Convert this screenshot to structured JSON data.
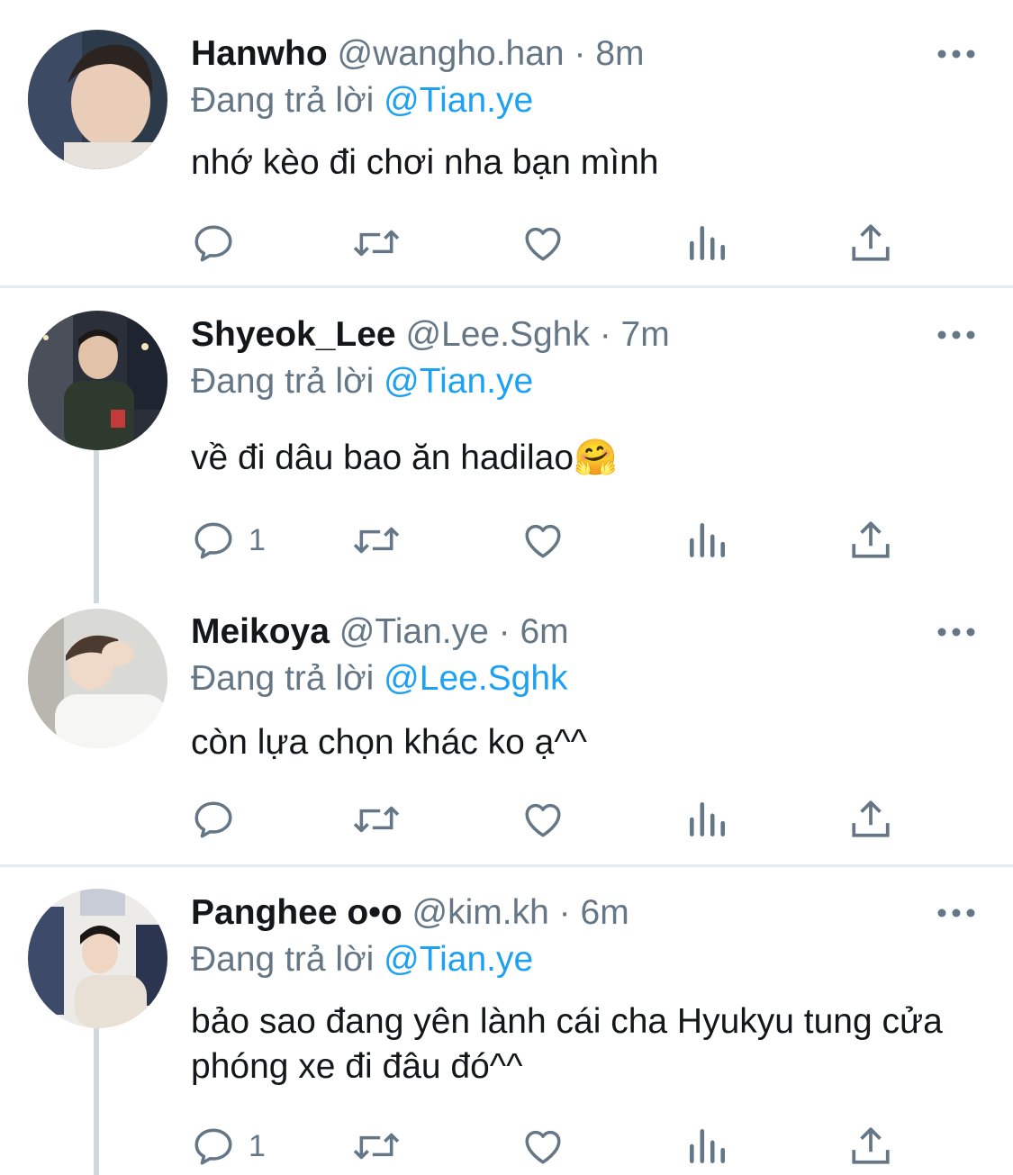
{
  "colors": {
    "accent": "#1da1f2",
    "secondary_text": "#657786",
    "divider": "#e6ecf0"
  },
  "tweets": [
    {
      "name": "Hanwho",
      "handle": "@wangho.han",
      "dot": "·",
      "time": "8m",
      "reply_prefix": "Đang trả lời",
      "reply_to": "@Tian.ye",
      "text": "nhớ kèo đi chơi nha bạn mình",
      "reply_count": ""
    },
    {
      "name": "Shyeok_Lee",
      "handle": "@Lee.Sghk",
      "dot": "·",
      "time": "7m",
      "reply_prefix": "Đang trả lời",
      "reply_to": "@Tian.ye",
      "text": "về đi dâu bao ăn hadilao🤗",
      "reply_count": "1"
    },
    {
      "name": "Meikoya",
      "handle": "@Tian.ye",
      "dot": "·",
      "time": "6m",
      "reply_prefix": "Đang trả lời",
      "reply_to": "@Lee.Sghk",
      "text": "còn lựa chọn khác ko ạ^^",
      "reply_count": ""
    },
    {
      "name": "Panghee o•o",
      "handle": "@kim.kh",
      "dot": "·",
      "time": "6m",
      "reply_prefix": "Đang trả lời",
      "reply_to": "@Tian.ye",
      "text": "bảo sao đang yên lành cái cha Hyukyu tung cửa phóng xe đi đâu đó^^",
      "reply_count": "1"
    }
  ],
  "icons": {
    "reply": "reply-icon",
    "retweet": "retweet-icon",
    "like": "heart-icon",
    "analytics": "analytics-icon",
    "share": "share-icon",
    "more": "more-icon"
  }
}
